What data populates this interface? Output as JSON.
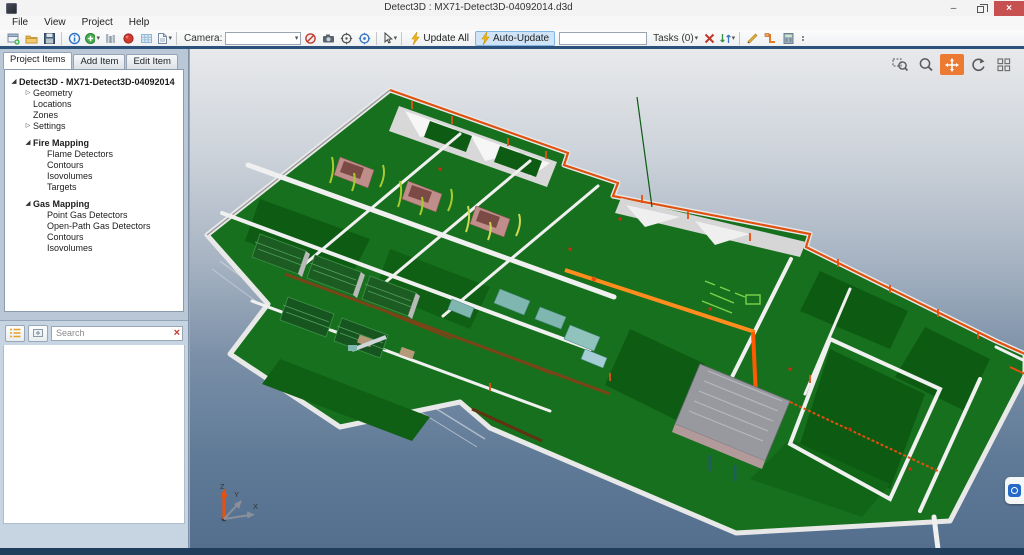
{
  "window": {
    "title": "Detect3D : MX71-Detect3D-04092014.d3d",
    "controls": {
      "minimize": "–",
      "close": "×"
    }
  },
  "menu": {
    "items": [
      {
        "label": "File"
      },
      {
        "label": "View"
      },
      {
        "label": "Project"
      },
      {
        "label": "Help"
      }
    ]
  },
  "toolbar": {
    "camera_label": "Camera:",
    "camera_value": "",
    "update_all_label": "Update All",
    "auto_update_label": "Auto-Update",
    "task_field_value": "",
    "tasks_label": "Tasks (0)",
    "icons": [
      "new-project",
      "open-project",
      "save",
      "info",
      "add-item",
      "columns",
      "record",
      "grid",
      "report",
      "camera-clear",
      "camera-capture",
      "camera-target",
      "camera-orbit",
      "select-cursor",
      "lightning",
      "tools-remove",
      "sort",
      "draw-line",
      "measure",
      "calculator",
      "overflow-grip"
    ]
  },
  "sidebar": {
    "tabs": [
      {
        "label": "Project Items",
        "active": true
      },
      {
        "label": "Add Item"
      },
      {
        "label": "Edit Item"
      }
    ],
    "tree": [
      {
        "label": "Detect3D - MX71-Detect3D-04092014",
        "level": 0,
        "bold": true,
        "expander": "expanded"
      },
      {
        "label": "Geometry",
        "level": 1,
        "expander": "collapsed"
      },
      {
        "label": "Locations",
        "level": 1
      },
      {
        "label": "Zones",
        "level": 1
      },
      {
        "label": "Settings",
        "level": 1,
        "expander": "collapsed"
      },
      {
        "label": "Fire Mapping",
        "level": 1,
        "bold": true,
        "expander": "expanded",
        "gap": true
      },
      {
        "label": "Flame Detectors",
        "level": 2
      },
      {
        "label": "Contours",
        "level": 2
      },
      {
        "label": "Isovolumes",
        "level": 2
      },
      {
        "label": "Targets",
        "level": 2
      },
      {
        "label": "Gas Mapping",
        "level": 1,
        "bold": true,
        "expander": "expanded",
        "gap": true
      },
      {
        "label": "Point Gas Detectors",
        "level": 2
      },
      {
        "label": "Open-Path Gas Detectors",
        "level": 2
      },
      {
        "label": "Contours",
        "level": 2
      },
      {
        "label": "Isovolumes",
        "level": 2
      }
    ],
    "search": {
      "placeholder": "Search",
      "clear_glyph": "×"
    }
  },
  "viewport": {
    "tools": [
      "zoom-window",
      "zoom",
      "pan",
      "rotate",
      "viewport-layout"
    ],
    "active_tool": "pan",
    "axis": {
      "x": "X",
      "y": "Y",
      "z": "Z"
    },
    "colors": {
      "tool_active": "#ED7A33",
      "site_green": "#17701D",
      "pipe_orange": "#FF6A00",
      "road_white": "#EFEFEF",
      "background_top": "#E8E9EB",
      "background_bottom": "#546F8E"
    }
  }
}
